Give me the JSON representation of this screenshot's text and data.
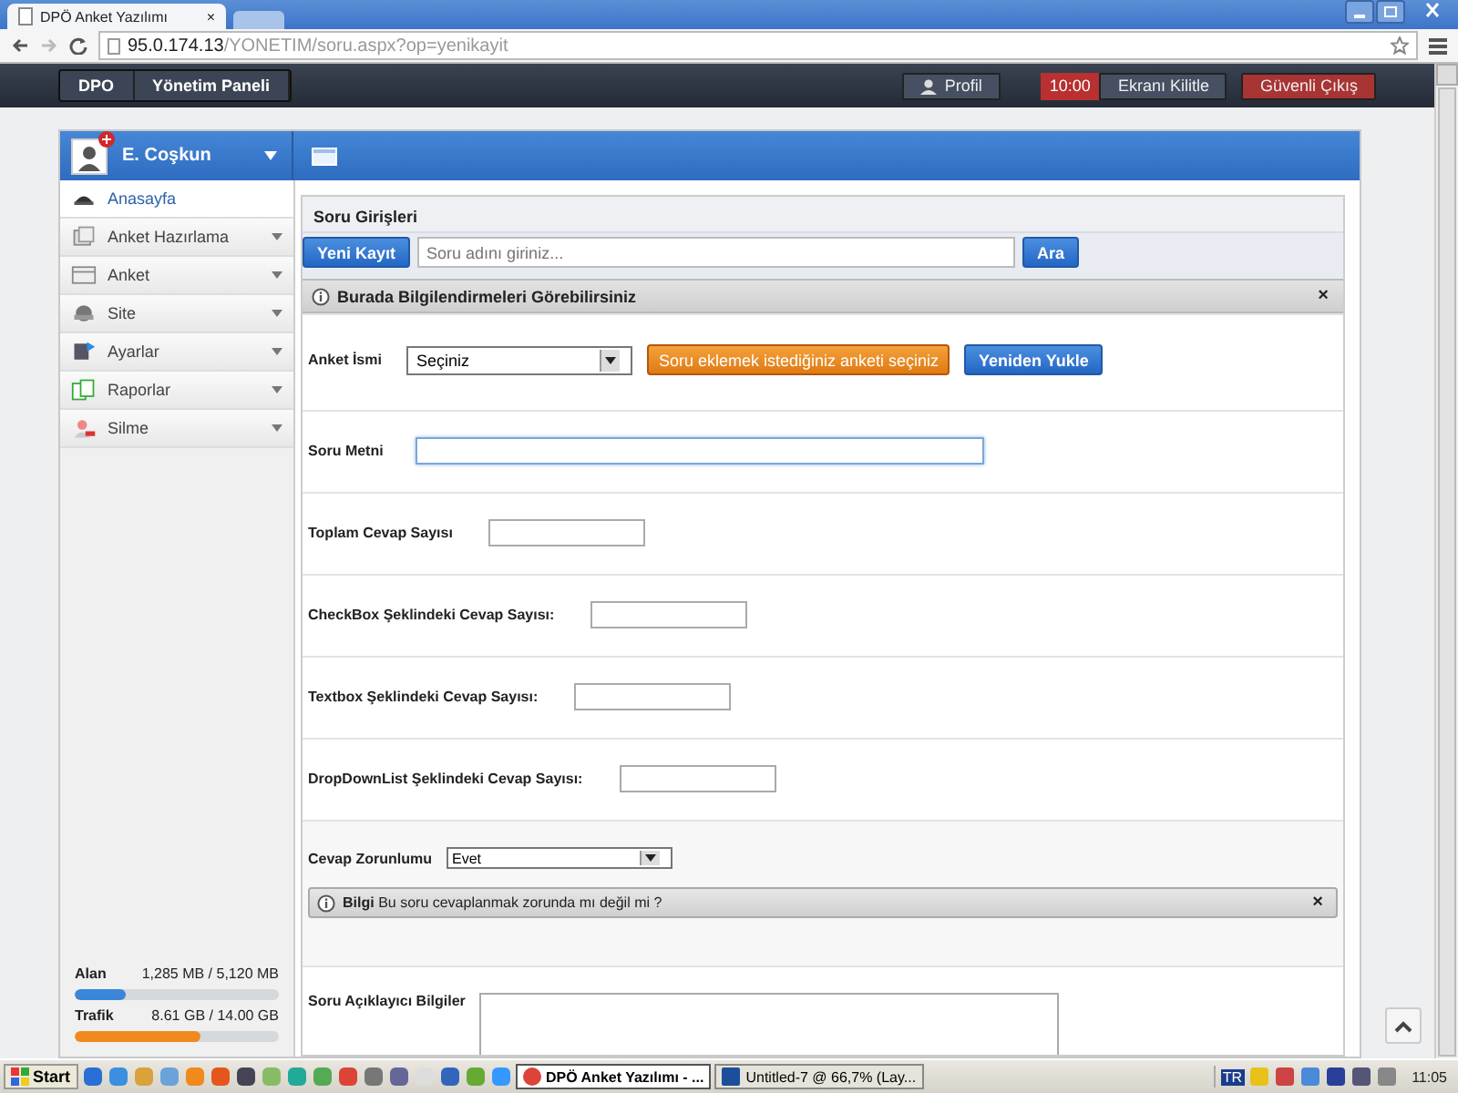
{
  "browser": {
    "tab_title": "DPÖ Anket Yazılımı",
    "tab_close": "×",
    "url_host": "95.0.174.13",
    "url_path": "/YONETIM/soru.aspx?op=yenikayit"
  },
  "header": {
    "breadcrumb": [
      "DPO",
      "Yönetim Paneli"
    ],
    "profile_button": "Profil",
    "lock_timer": "10:00",
    "lock_button": "Ekranı Kilitle",
    "logout_button": "Güvenli Çıkış"
  },
  "sidebar": {
    "user_name": "E. Coşkun",
    "items": [
      {
        "label": "Anasayfa",
        "selected": true,
        "expandable": false
      },
      {
        "label": "Anket Hazırlama",
        "selected": false,
        "expandable": true
      },
      {
        "label": "Anket",
        "selected": false,
        "expandable": true
      },
      {
        "label": "Site",
        "selected": false,
        "expandable": true
      },
      {
        "label": "Ayarlar",
        "selected": false,
        "expandable": true
      },
      {
        "label": "Raporlar",
        "selected": false,
        "expandable": true
      },
      {
        "label": "Silme",
        "selected": false,
        "expandable": true
      }
    ],
    "meters": [
      {
        "name": "Alan",
        "reading": "1,285 MB / 5,120 MB",
        "level": 0.25,
        "color": "#3a86d8"
      },
      {
        "name": "Trafik",
        "reading": "8.61 GB / 14.00 GB",
        "level": 0.62,
        "color": "#f08a1c"
      }
    ]
  },
  "content": {
    "title": "Soru Girişleri",
    "new_button": "Yeni Kayıt",
    "search_placeholder": "Soru adını giriniz...",
    "search_button": "Ara",
    "notice": {
      "text": "Burada Bilgilendirmeleri Görebilirsiniz",
      "close": "×"
    },
    "rows": [
      {
        "kind": "select",
        "label": "Anket İsmi",
        "value": "Seçiniz",
        "buttons": [
          {
            "label": "Soru eklemek istediğiniz anketi seçiniz",
            "kind": "warning"
          },
          {
            "label": "Yeniden Yukle",
            "kind": "primary"
          }
        ]
      },
      {
        "kind": "wide_text",
        "label": "Soru Metni",
        "focused": true
      },
      {
        "kind": "text",
        "label": "Toplam Cevap Sayısı",
        "focused": false
      },
      {
        "kind": "text",
        "label": "CheckBox Şeklindeki Cevap Sayısı:",
        "focused": false
      },
      {
        "kind": "text",
        "label": "Textbox Şeklindeki Cevap Sayısı:",
        "focused": false
      },
      {
        "kind": "text",
        "label": "DropDownList Şeklindeki Cevap Sayısı:",
        "focused": false
      },
      {
        "kind": "small_select",
        "label": "Cevap Zorunlumu",
        "value": "Evet",
        "alert": {
          "text": "**Bilgi** Bu soru cevaplanmak zorunda mı değil mi ?",
          "close": "×"
        }
      },
      {
        "kind": "textarea",
        "label": "Soru Açıklayıcı Bilgiler"
      }
    ]
  },
  "taskbar": {
    "start": "Start",
    "windows": [
      {
        "label": "DPÖ Anket Yazılımı - ...",
        "selected": true
      },
      {
        "label": "Untitled-7 @ 66,7% (Lay...",
        "selected": false
      }
    ],
    "language": "TR",
    "clock": "11:05"
  }
}
